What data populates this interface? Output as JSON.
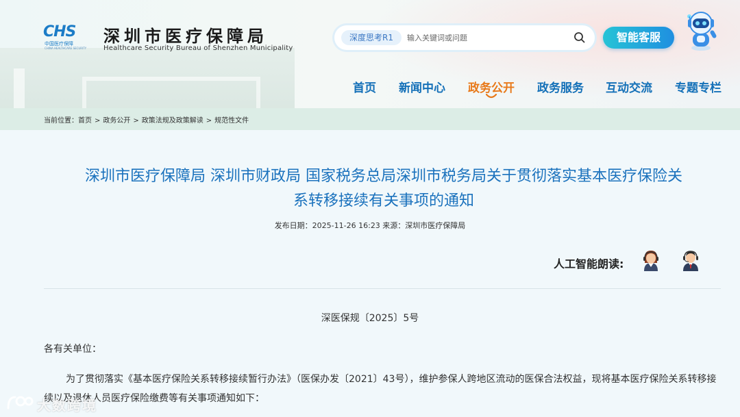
{
  "header": {
    "logo_mark": "CHS",
    "logo_sub": "中国医疗保障",
    "logo_sub_en": "CHINA HEALTHCARE SECURITY",
    "org_name_cn": "深圳市医疗保障局",
    "org_name_en": "Healthcare Security Bureau of Shenzhen Municipality",
    "search": {
      "tag": "深度思考R1",
      "placeholder": "输入关键词或问题",
      "icon": "search-icon"
    },
    "ai_service_label": "智能客服",
    "robot_icon": "robot-mascot-icon"
  },
  "nav": {
    "items": [
      {
        "label": "首页"
      },
      {
        "label": "新闻中心"
      },
      {
        "label": "政务公开",
        "active": true
      },
      {
        "label": "政务服务"
      },
      {
        "label": "互动交流"
      },
      {
        "label": "专题专栏"
      }
    ],
    "active_color": "#e8791a",
    "color": "#1470b8"
  },
  "breadcrumb": {
    "prefix": "当前位置：",
    "items": [
      "首页",
      "政务公开",
      "政策法规及政策解读",
      "规范性文件"
    ]
  },
  "article": {
    "title_line1": "深圳市医疗保障局 深圳市财政局 国家税务总局深圳市税务局关于贯彻落实基本医疗保险关",
    "title_line2": "系转移接续有关事项的通知",
    "meta": "发布日期：2025-11-26 16:23 来源：深圳市医疗保障局",
    "reader_label": "人工智能朗读:",
    "reader_female_icon": "female-reader-icon",
    "reader_male_icon": "male-reader-icon",
    "doc_number": "深医保规〔2025〕5号",
    "salutation": "各有关单位：",
    "paragraph": "为了贯彻落实《基本医疗保险关系转移接续暂行办法》（医保办发〔2021〕43号），维护参保人跨地区流动的医保合法权益，现将基本医疗保险关系转移接续以及退休人员医疗保险缴费等有关事项通知如下："
  },
  "watermark": {
    "text": "大数跨境"
  }
}
